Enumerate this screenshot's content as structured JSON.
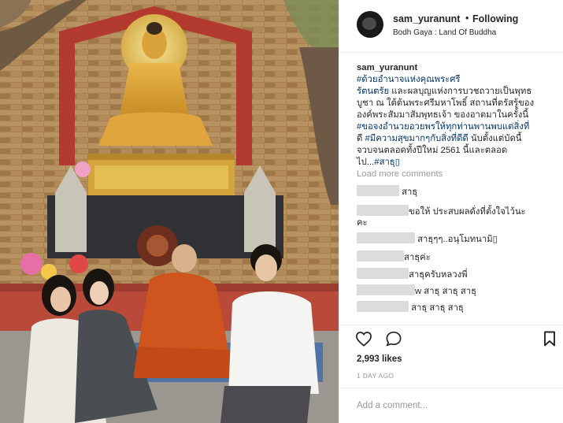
{
  "post": {
    "username": "sam_yuranunt",
    "separator": "•",
    "follow_label": "Following",
    "location": "Bodh Gaya : Land Of Buddha",
    "caption_user": "sam_yuranunt",
    "caption_lines": [
      {
        "pre": "",
        "hash": "#ด้วยอำนาจแห่งคุณพระศรี",
        "post": ""
      },
      {
        "pre": "",
        "hash": "รัตนตรัย",
        "post": " และผลบุญแห่งการบวชถวายเป็นพุทธ"
      },
      {
        "pre": "บูชา ณ ใต้ต้นพระศรีมหาโพธิ์ สถานที่ตรัสรู้ของ",
        "hash": "",
        "post": ""
      },
      {
        "pre": "องค์พระสัมมาสัมพุทธเจ้า ของอาตมาในครั้งนี้",
        "hash": "",
        "post": ""
      },
      {
        "pre": "",
        "hash": "#ขอจงอำนวยอวยพรให้ทุกท่านพานพบแต่สิ่งที่",
        "post": ""
      },
      {
        "pre": "ดี ",
        "hash": "#มีความสุขมากๆกับสิ่งที่ดีดี",
        "post": " นับตั้งแต่บัดนี้"
      },
      {
        "pre": "จวบจนตลอดทั้งปีใหม่ 2561 นี้และตลอด",
        "hash": "",
        "post": ""
      },
      {
        "pre": "ไป...",
        "hash": "#สาธุ▯",
        "post": ""
      }
    ],
    "load_more": "Load more comments",
    "comments": [
      {
        "text": "สาธุ"
      },
      {
        "text": "ขอให้ ประสบผลดั่งที่ตั้งใจไว้นะ"
      },
      {
        "text": "คะ"
      },
      {
        "text": "สาธุๆๆ..อนุโมทนามิ▯"
      },
      {
        "text": "สาธุค่ะ"
      },
      {
        "text": "สาธุครับหลวงพี่"
      },
      {
        "text": "w สาธุ สาธุ สาธุ"
      },
      {
        "text": "สาธุ สาธุ สาธุ"
      }
    ],
    "likes": "2,993 likes",
    "time_ago": "1 DAY AGO",
    "add_comment": "Add a comment..."
  },
  "icons": [
    "heart-icon",
    "comment-icon",
    "bookmark-icon"
  ],
  "colors": {
    "hashtag": "#003569",
    "muted": "#999999",
    "text": "#262626",
    "border": "#efefef"
  }
}
